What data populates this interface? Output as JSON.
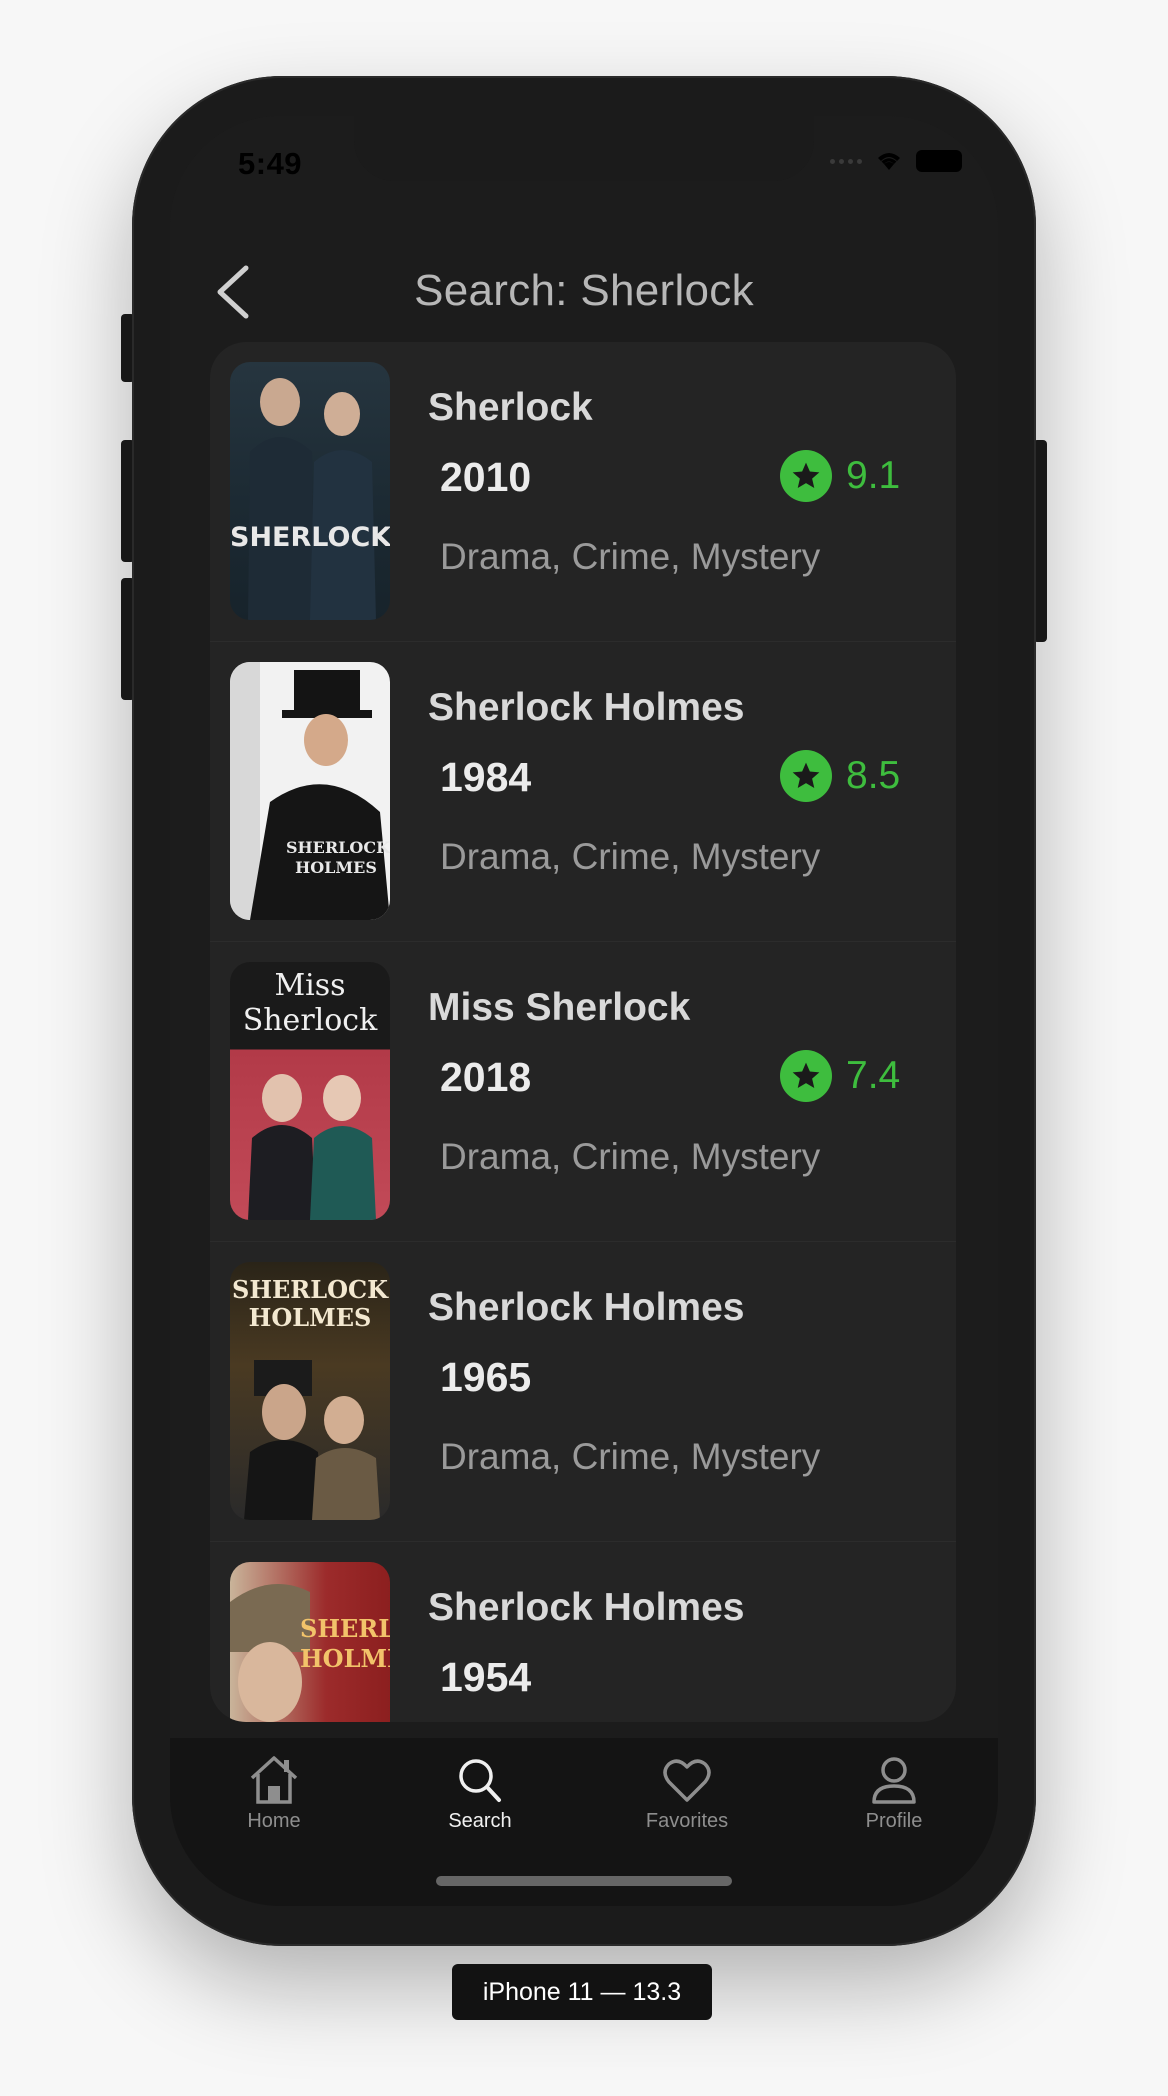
{
  "status_bar": {
    "time": "5:49"
  },
  "header": {
    "title": "Search: Sherlock"
  },
  "results": [
    {
      "title": "Sherlock",
      "year": "2010",
      "rating": "9.1",
      "genres": "Drama, Crime, Mystery",
      "poster_text": "SHERLOCK"
    },
    {
      "title": "Sherlock Holmes",
      "year": "1984",
      "rating": "8.5",
      "genres": "Drama, Crime, Mystery",
      "poster_text": "SHERLOCK HOLMES"
    },
    {
      "title": "Miss Sherlock",
      "year": "2018",
      "rating": "7.4",
      "genres": "Drama, Crime, Mystery",
      "poster_text": "Miss Sherlock"
    },
    {
      "title": "Sherlock Holmes",
      "year": "1965",
      "rating": null,
      "genres": "Drama, Crime, Mystery",
      "poster_text": "SHERLOCK HOLMES"
    },
    {
      "title": "Sherlock Holmes",
      "year": "1954",
      "rating": null,
      "genres": "",
      "poster_text": "SHERLOCK HOLMES"
    }
  ],
  "tabbar": {
    "items": [
      {
        "label": "Home",
        "icon": "home-icon"
      },
      {
        "label": "Search",
        "icon": "search-icon",
        "active": true
      },
      {
        "label": "Favorites",
        "icon": "heart-icon"
      },
      {
        "label": "Profile",
        "icon": "person-icon"
      }
    ]
  },
  "device_caption": "iPhone 11 — 13.3",
  "colors": {
    "accent": "#3ebd3e",
    "background": "#1c1c1c",
    "card": "#242424"
  }
}
